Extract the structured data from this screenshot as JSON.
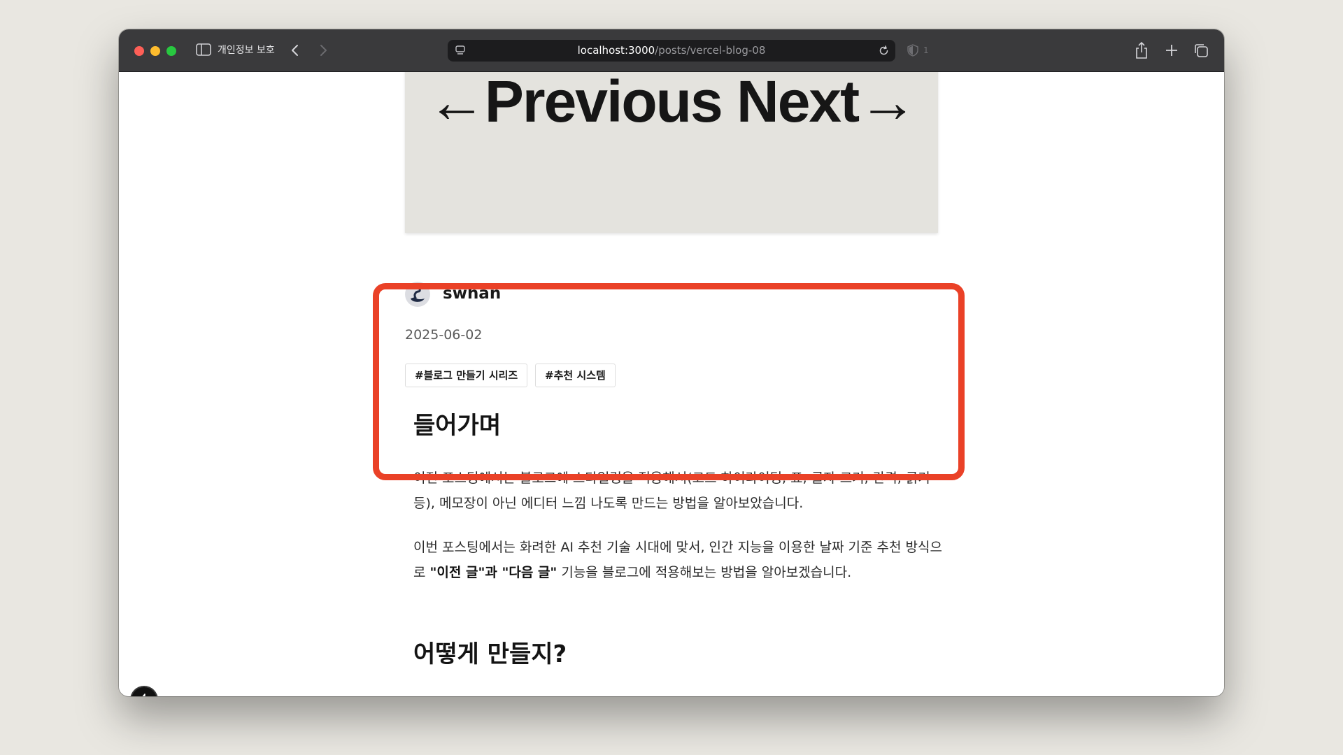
{
  "browser": {
    "privacy_label": "개인정보 보호",
    "url_host": "localhost:3000",
    "url_path": "/posts/vercel-blog-08",
    "blocked_count": "1"
  },
  "post": {
    "cover_text": "←Previous  Next→",
    "author": "swhan",
    "date": "2025-06-02",
    "tags": [
      "#블로그 만들기 시리즈",
      "#추천 시스템"
    ],
    "heading1": "들어가며",
    "para1": "이전 포스팅에서는 블로그에 스타일링을 적용해서(코드 하이라이팅, 표, 글자 크기, 간격, 굵기 등), 메모장이 아닌 에디터 느낌 나도록 만드는 방법을 알아보았습니다.",
    "para2_before": "이번 포스팅에서는 화려한 AI 추천 기술 시대에 맞서, 인간 지능을 이용한 날짜 기준 추천 방식으로 ",
    "para2_bold": "\"이전 글\"과 \"다음 글\"",
    "para2_after": " 기능을 블로그에 적용해보는 방법을 알아보겠습니다.",
    "heading2": "어떻게 만들지?"
  },
  "colors": {
    "highlight": "#ea4127",
    "cover_bg": "#e4e3de",
    "titlebar": "#3a3a3c"
  }
}
